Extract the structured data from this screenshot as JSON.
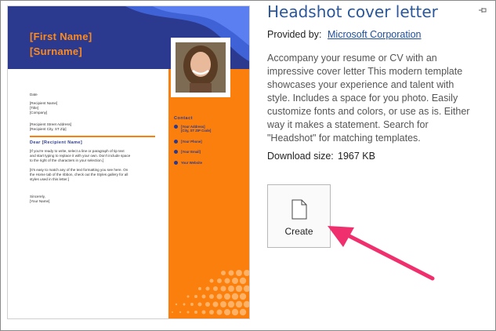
{
  "template_preview": {
    "first_name": "[First Name]",
    "surname": "[Surname]",
    "date": "Date",
    "recipient_block": "[Recipient Name]\n[Title]\n[Company]",
    "recipient_address": "[Recipient Street Address]\n[Recipient City, ST Zip]",
    "greeting": "Dear [Recipient Name]",
    "body_1": "[If you're ready to write, select a line or paragraph of tip text\nand start typing to replace it with your own. Don't include space\nto the right of the characters in your selection.]",
    "body_2": "[It's easy to match any of the text formatting you see here. On\nthe Home tab of the ribbon, check out the Styles gallery for all\nstyles used in this letter.]",
    "closing": "Sincerely,\n[Your Name]",
    "contact_title": "Contact",
    "address": "[Your Address]\n[City, ST ZIP Code]",
    "phone": "[Your Phone]",
    "email": "[Your Email]",
    "website": "Your Website"
  },
  "details": {
    "title": "Headshot cover letter",
    "provided_by_label": "Provided by:",
    "provider": "Microsoft Corporation",
    "description": "Accompany your resume or CV with an impressive cover letter This modern template showcases your experience and talent with style. Includes a space for you photo. Easily customize fonts and colors, or use as is. Either way it makes a statement. Search for \"Headshot\" for matching templates.",
    "download_label": "Download size:",
    "download_size": "1967 KB",
    "create_label": "Create"
  },
  "colors": {
    "title_blue": "#2b579a",
    "template_navy": "#2b3a8f",
    "template_orange": "#fb7f0d",
    "arrow_pink": "#f0306e"
  }
}
